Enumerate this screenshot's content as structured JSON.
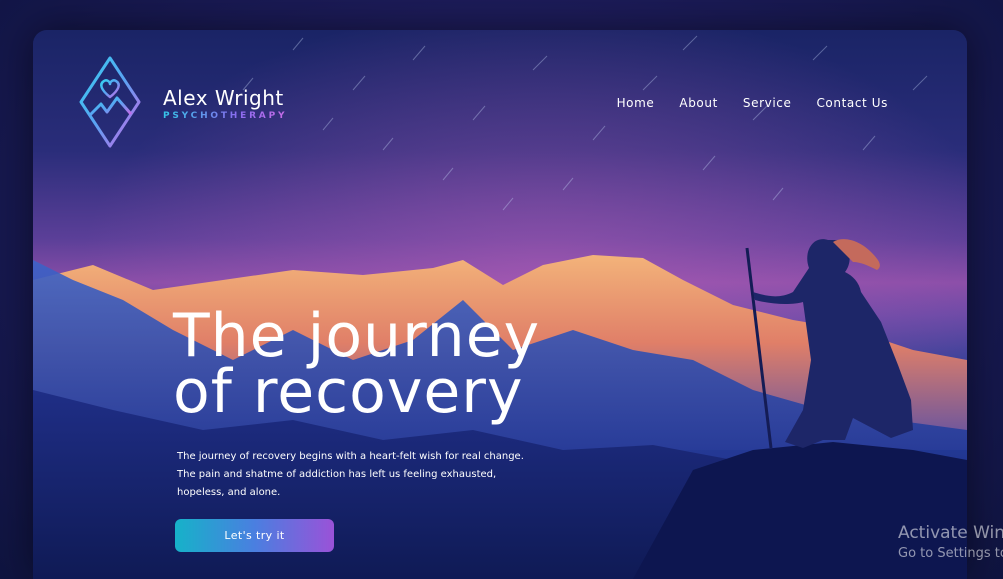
{
  "brand": {
    "name": "Alex Wright",
    "tagline": "PSYCHOTHERAPY",
    "logo_icon": "heart-mountain-diamond-icon"
  },
  "nav": {
    "items": [
      {
        "label": "Home"
      },
      {
        "label": "About"
      },
      {
        "label": "Service"
      },
      {
        "label": "Contact Us"
      }
    ]
  },
  "hero": {
    "title_line1": "The journey",
    "title_line2": "of recovery",
    "text_line1": "The journey of recovery begins with a heart-felt wish for real change.",
    "text_line2": "The pain and shatme of addiction has left us feeling exhausted,",
    "text_line3": "hopeless, and alone.",
    "cta_label": "Let's try it"
  },
  "os_watermark": {
    "line1": "Activate Windows",
    "line2": "Go to Settings to activate Windows."
  },
  "colors": {
    "accent_start": "#16b2c9",
    "accent_end": "#9a52d8",
    "sky_purple": "#8a4ea8",
    "night_blue": "#1a2466",
    "peak_orange": "#f0a868"
  }
}
